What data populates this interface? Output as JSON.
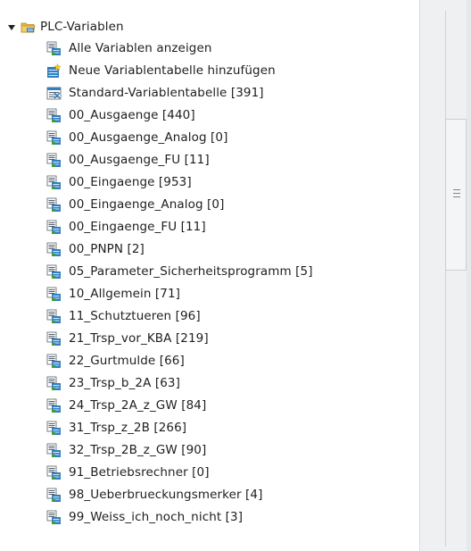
{
  "tree": {
    "root": {
      "label": "PLC-Variablen",
      "expanded": true
    },
    "actions": [
      {
        "label": "Alle Variablen anzeigen",
        "icon": "show-all-tags-icon"
      },
      {
        "label": "Neue Variablentabelle hinzufügen",
        "icon": "add-tag-table-icon"
      },
      {
        "label": "Standard-Variablentabelle [391]",
        "icon": "default-tag-table-icon"
      }
    ],
    "tables": [
      {
        "label": "00_Ausgaenge [440]"
      },
      {
        "label": "00_Ausgaenge_Analog [0]"
      },
      {
        "label": "00_Ausgaenge_FU [11]"
      },
      {
        "label": "00_Eingaenge [953]"
      },
      {
        "label": "00_Eingaenge_Analog [0]"
      },
      {
        "label": "00_Eingaenge_FU [11]"
      },
      {
        "label": "00_PNPN [2]"
      },
      {
        "label": "05_Parameter_Sicherheitsprogramm [5]"
      },
      {
        "label": "10_Allgemein [71]"
      },
      {
        "label": "11_Schutztueren [96]"
      },
      {
        "label": "21_Trsp_vor_KBA [219]"
      },
      {
        "label": "22_Gurtmulde [66]"
      },
      {
        "label": "23_Trsp_b_2A [63]"
      },
      {
        "label": "24_Trsp_2A_z_GW [84]"
      },
      {
        "label": "31_Trsp_z_2B [266]"
      },
      {
        "label": "32_Trsp_2B_z_GW [90]"
      },
      {
        "label": "91_Betriebsrechner [0]"
      },
      {
        "label": "98_Ueberbrueckungsmerker [4]"
      },
      {
        "label": "99_Weiss_ich_noch_nicht [3]"
      }
    ]
  },
  "colors": {
    "folder": "#e8b547",
    "table_blue": "#2f7fc1",
    "table_green": "#3f9a3b",
    "text": "#1e1e1e"
  }
}
